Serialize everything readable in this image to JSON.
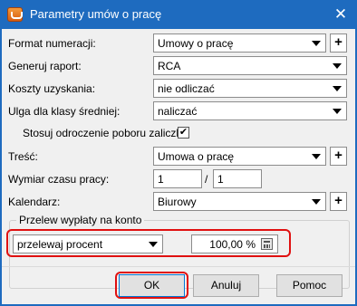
{
  "window": {
    "title": "Parametry umów o pracę",
    "close_glyph": "✕",
    "app_icon": "app-icon"
  },
  "form": {
    "numbering_format": {
      "label": "Format numeracji:",
      "value": "Umowy o pracę"
    },
    "report": {
      "label": "Generuj raport:",
      "value": "RCA"
    },
    "costs": {
      "label": "Koszty uzyskania:",
      "value": "nie odliczać"
    },
    "middle_class_relief": {
      "label": "Ulga dla klasy średniej:",
      "value": "naliczać"
    },
    "deferral": {
      "label": "Stosuj odroczenie poboru zaliczki:",
      "checked_glyph": "✔"
    },
    "content": {
      "label": "Treść:",
      "value": "Umowa o pracę"
    },
    "working_time": {
      "label": "Wymiar czasu pracy:",
      "numerator": "1",
      "separator": "/",
      "denominator": "1"
    },
    "calendar": {
      "label": "Kalendarz:",
      "value": "Biurowy"
    },
    "plus_glyph": "+"
  },
  "transfer": {
    "group_title": "Przelew wypłaty na konto",
    "mode": "przelewaj procent",
    "percent": "100,00 %"
  },
  "buttons": {
    "ok": "OK",
    "cancel": "Anuluj",
    "help": "Pomoc"
  },
  "colors": {
    "titlebar": "#1e6bbf",
    "highlight": "#e01010"
  }
}
